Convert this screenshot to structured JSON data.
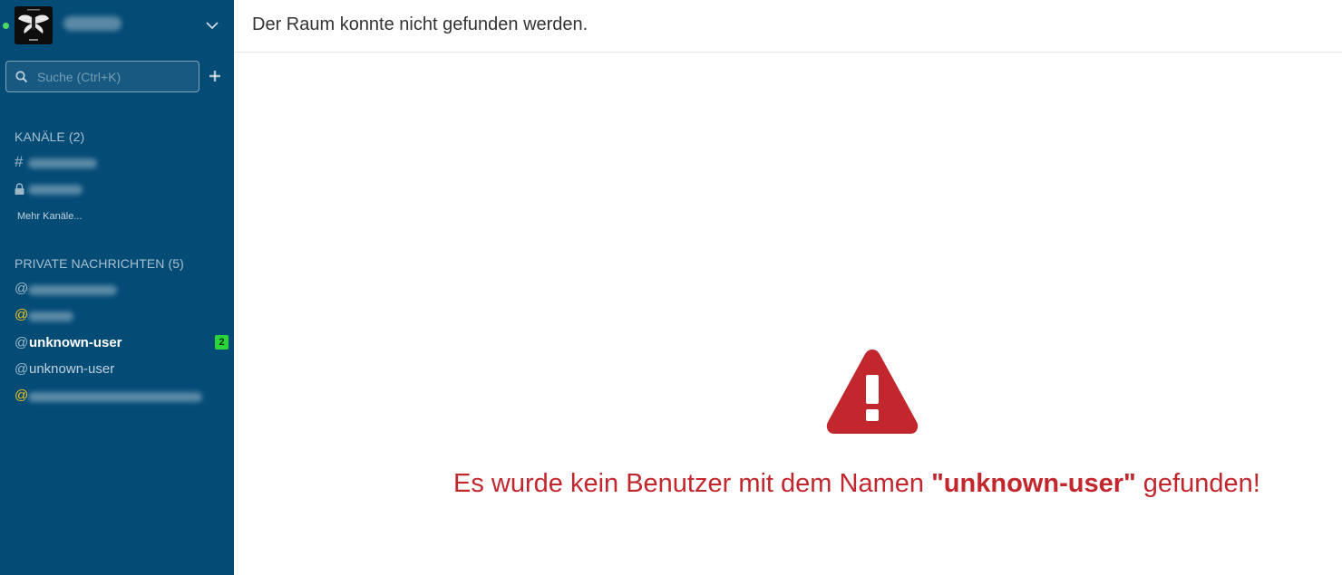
{
  "sidebar": {
    "search": {
      "placeholder": "Suche (Ctrl+K)"
    },
    "channels": {
      "title": "KANÄLE (2)",
      "items": [
        {
          "symbol": "#"
        },
        {
          "symbol": "🔒"
        }
      ],
      "more_label": "Mehr Kanäle..."
    },
    "dms": {
      "title": "PRIVATE NACHRICHTEN (5)",
      "items": [
        {
          "symbol": "@"
        },
        {
          "symbol": "@"
        },
        {
          "symbol": "@",
          "label": "unknown-user",
          "badge": "2"
        },
        {
          "symbol": "@",
          "label": "unknown-user"
        },
        {
          "symbol": "@"
        }
      ]
    }
  },
  "main": {
    "title": "Der Raum konnte nicht gefunden werden.",
    "error": {
      "prefix": "Es wurde kein Benutzer mit dem Namen ",
      "name": "\"unknown-user\"",
      "suffix": " gefunden!"
    }
  },
  "colors": {
    "sidebar_bg": "#044b76",
    "online": "#4cd964",
    "away": "#f5c31a",
    "badge": "#2cd43a",
    "error": "#c1272d"
  }
}
